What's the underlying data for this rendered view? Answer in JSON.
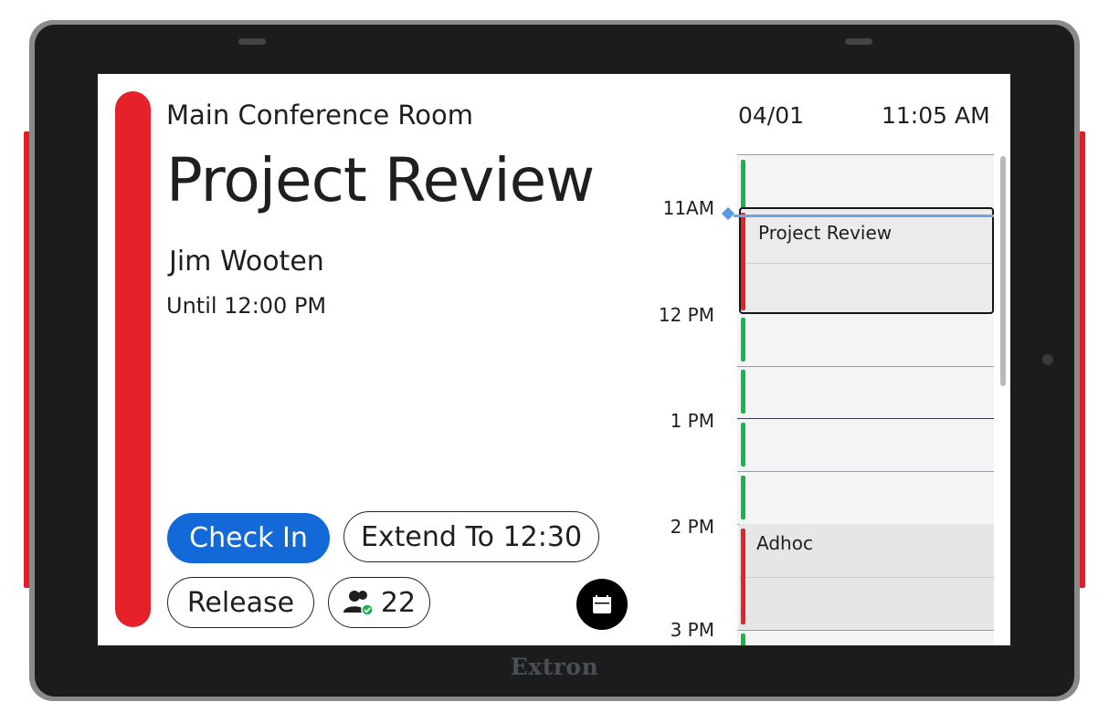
{
  "device": {
    "brand": "Extron",
    "status_color": "#e52129",
    "accent_color": "#1369d8"
  },
  "header": {
    "room_name": "Main Conference Room",
    "date": "04/01",
    "time": "11:05 AM"
  },
  "meeting": {
    "title": "Project Review",
    "organizer": "Jim Wooten",
    "until": "Until 12:00 PM"
  },
  "actions": {
    "check_in_label": "Check In",
    "extend_label": "Extend To 12:30",
    "release_label": "Release",
    "attendee_count": "22",
    "attendee_icon": "attendees-checked-icon",
    "calendar_icon": "calendar-icon"
  },
  "schedule": {
    "time_labels": [
      "11AM",
      "12 PM",
      "1 PM",
      "2 PM",
      "3 PM"
    ],
    "events": [
      {
        "title": "Project Review"
      },
      {
        "title": "Adhoc"
      }
    ],
    "available_color": "#16b44c",
    "booked_color": "#e52129"
  }
}
